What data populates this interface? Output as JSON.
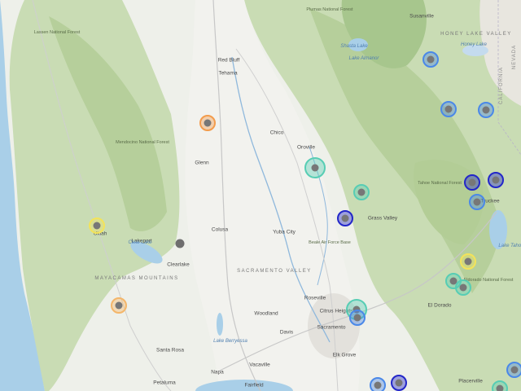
{
  "map": {
    "place_labels": [
      {
        "id": "susanville",
        "text": "Susanville",
        "cls": "city"
      },
      {
        "id": "red-bluff",
        "text": "Red Bluff",
        "cls": "city"
      },
      {
        "id": "tehama",
        "text": "Tehama",
        "cls": "city"
      },
      {
        "id": "chico",
        "text": "Chico",
        "cls": "city"
      },
      {
        "id": "oroville",
        "text": "Oroville",
        "cls": "city"
      },
      {
        "id": "glenn",
        "text": "Glenn",
        "cls": "city"
      },
      {
        "id": "colusa",
        "text": "Colusa",
        "cls": "city"
      },
      {
        "id": "yuba-city",
        "text": "Yuba City",
        "cls": "city"
      },
      {
        "id": "grass-valley",
        "text": "Grass Valley",
        "cls": "city"
      },
      {
        "id": "beale",
        "text": "Beale Air Force Base",
        "cls": "park"
      },
      {
        "id": "roseville",
        "text": "Roseville",
        "cls": "city"
      },
      {
        "id": "citrus-heights",
        "text": "Citrus Heights",
        "cls": "city"
      },
      {
        "id": "woodland",
        "text": "Woodland",
        "cls": "city"
      },
      {
        "id": "davis",
        "text": "Davis",
        "cls": "city"
      },
      {
        "id": "sacramento",
        "text": "Sacramento",
        "cls": "city"
      },
      {
        "id": "elk-grove",
        "text": "Elk Grove",
        "cls": "city"
      },
      {
        "id": "santa-rosa",
        "text": "Santa Rosa",
        "cls": "city"
      },
      {
        "id": "napa",
        "text": "Napa",
        "cls": "city"
      },
      {
        "id": "vacaville",
        "text": "Vacaville",
        "cls": "city"
      },
      {
        "id": "fairfield",
        "text": "Fairfield",
        "cls": "city"
      },
      {
        "id": "petaluma",
        "text": "Petaluma",
        "cls": "city"
      },
      {
        "id": "clearlake",
        "text": "Clearlake",
        "cls": "city"
      },
      {
        "id": "lakeport",
        "text": "Lakeport",
        "cls": "city"
      },
      {
        "id": "ukiah",
        "text": "Ukiah",
        "cls": "city"
      },
      {
        "id": "el-dorado",
        "text": "El Dorado",
        "cls": "city"
      },
      {
        "id": "truckee",
        "text": "Truckee",
        "cls": "city"
      },
      {
        "id": "placerville",
        "text": "Placerville",
        "cls": "city"
      },
      {
        "id": "sacramento-valley",
        "text": "SACRAMENTO VALLEY",
        "cls": "region"
      },
      {
        "id": "mayacamas",
        "text": "MAYACAMAS MOUNTAINS",
        "cls": "region"
      },
      {
        "id": "honey-lake-valley",
        "text": "HONEY LAKE VALLEY",
        "cls": "region"
      },
      {
        "id": "shasta-lake",
        "text": "Shasta Lake",
        "cls": "water"
      },
      {
        "id": "lake-almanor",
        "text": "Lake Almanor",
        "cls": "water"
      },
      {
        "id": "honey-lake",
        "text": "Honey Lake",
        "cls": "water"
      },
      {
        "id": "clear-lake",
        "text": "Clear Lake",
        "cls": "water"
      },
      {
        "id": "lake-berryessa",
        "text": "Lake Berryessa",
        "cls": "water"
      },
      {
        "id": "lake-tahoe",
        "text": "Lake Tahoe",
        "cls": "water"
      },
      {
        "id": "tahoe-nf",
        "text": "Tahoe National Forest",
        "cls": "park"
      },
      {
        "id": "plumas-nf",
        "text": "Plumas National Forest",
        "cls": "park"
      },
      {
        "id": "mendocino-nf",
        "text": "Mendocino National Forest",
        "cls": "park"
      },
      {
        "id": "eldorado-nf",
        "text": "Eldorado National Forest",
        "cls": "park"
      },
      {
        "id": "lassen-nf",
        "text": "Lassen National Forest",
        "cls": "park"
      },
      {
        "id": "california",
        "text": "CALIFORNIA",
        "cls": "state"
      },
      {
        "id": "nevada",
        "text": "NEVADA",
        "cls": "state"
      }
    ],
    "marker_colors": {
      "orange": "#f39c4c",
      "yellow": "#f3e35a",
      "light-orange": "#f4b66a",
      "teal": "#57cdb4",
      "blue": "#4a88e8",
      "dark-blue": "#2327c9",
      "gray": "#6e6e6e"
    },
    "markers": [
      {
        "id": "m01",
        "color": "orange"
      },
      {
        "id": "m02",
        "color": "yellow"
      },
      {
        "id": "m03",
        "color": "light-orange"
      },
      {
        "id": "m04",
        "color": "gray"
      },
      {
        "id": "m05",
        "color": "teal"
      },
      {
        "id": "m06",
        "color": "teal"
      },
      {
        "id": "m07",
        "color": "dark-blue"
      },
      {
        "id": "m08",
        "color": "blue"
      },
      {
        "id": "m09",
        "color": "blue"
      },
      {
        "id": "m10",
        "color": "blue"
      },
      {
        "id": "m11",
        "color": "dark-blue"
      },
      {
        "id": "m12",
        "color": "dark-blue"
      },
      {
        "id": "m13",
        "color": "blue"
      },
      {
        "id": "m14",
        "color": "yellow"
      },
      {
        "id": "m15",
        "color": "teal"
      },
      {
        "id": "m16",
        "color": "teal"
      },
      {
        "id": "m17",
        "color": "teal"
      },
      {
        "id": "m18",
        "color": "blue"
      },
      {
        "id": "m19",
        "color": "blue"
      },
      {
        "id": "m20",
        "color": "dark-blue"
      },
      {
        "id": "m21",
        "color": "blue"
      },
      {
        "id": "m22",
        "color": "teal"
      }
    ]
  }
}
